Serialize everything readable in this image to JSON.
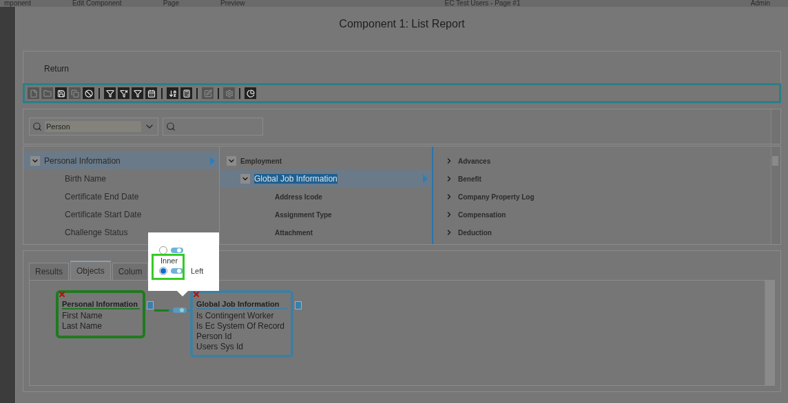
{
  "top_bar": {
    "items": [
      "mponent",
      "Edit Component",
      "Page",
      "Preview",
      "EC Test Users - Page #1",
      "Admin"
    ]
  },
  "dialog": {
    "title": "Component 1: List Report",
    "return_label": "Return",
    "toolbar": [
      [
        {
          "disabled": true
        },
        {
          "disabled": true
        },
        {
          "disabled": false
        },
        {
          "disabled": true
        },
        {
          "disabled": false
        }
      ],
      [
        {
          "disabled": false
        },
        {
          "disabled": false
        },
        {
          "disabled": false
        },
        {
          "disabled": false
        }
      ],
      [
        {
          "disabled": false
        },
        {
          "disabled": false
        }
      ],
      [
        {
          "disabled": true
        }
      ],
      [
        {
          "disabled": true
        }
      ],
      [
        {
          "disabled": false
        }
      ]
    ],
    "search": {
      "object_value": "Person"
    },
    "columns": [
      {
        "items": [
          {
            "label": "Personal Information",
            "expanded": true,
            "selected": true,
            "children": [
              {
                "label": "Birth Name"
              },
              {
                "label": "Certificate End Date"
              },
              {
                "label": "Certificate Start Date"
              },
              {
                "label": "Challenge Status"
              }
            ]
          }
        ]
      },
      {
        "items": [
          {
            "label": "Employment",
            "expanded": true,
            "selected": false,
            "children": [
              {
                "label": "Global Job Information",
                "expanded": true,
                "selected": true,
                "children": [
                  {
                    "label": "Address Icode"
                  },
                  {
                    "label": "Assignment Type"
                  },
                  {
                    "label": "Attachment"
                  }
                ]
              }
            ]
          }
        ]
      },
      {
        "items": [
          {
            "label": "Advances",
            "expanded": false,
            "selected": false
          },
          {
            "label": "Benefit",
            "expanded": false,
            "selected": false
          },
          {
            "label": "Company Property Log",
            "expanded": false,
            "selected": false
          },
          {
            "label": "Compensation",
            "expanded": false,
            "selected": false
          },
          {
            "label": "Deduction",
            "expanded": false,
            "selected": false
          }
        ]
      }
    ],
    "tabs": [
      {
        "label": "Results",
        "selected": false
      },
      {
        "label": "Objects",
        "selected": true
      },
      {
        "label": "Colum",
        "selected": false
      }
    ],
    "nodes": [
      {
        "title": "Personal Information",
        "color": "#1f7a1f",
        "fields": [
          "First Name",
          "Last Name"
        ]
      },
      {
        "title": "Global Job Information",
        "color": "#3f7fa0",
        "fields": [
          "Is Contingent Worker",
          "Is Ec System Of Record",
          "Person Id",
          "Users Sys Id"
        ]
      }
    ],
    "join_popup": {
      "options": [
        {
          "label": "Inner",
          "selected": false
        },
        {
          "label": "Left",
          "selected": true
        }
      ]
    }
  }
}
